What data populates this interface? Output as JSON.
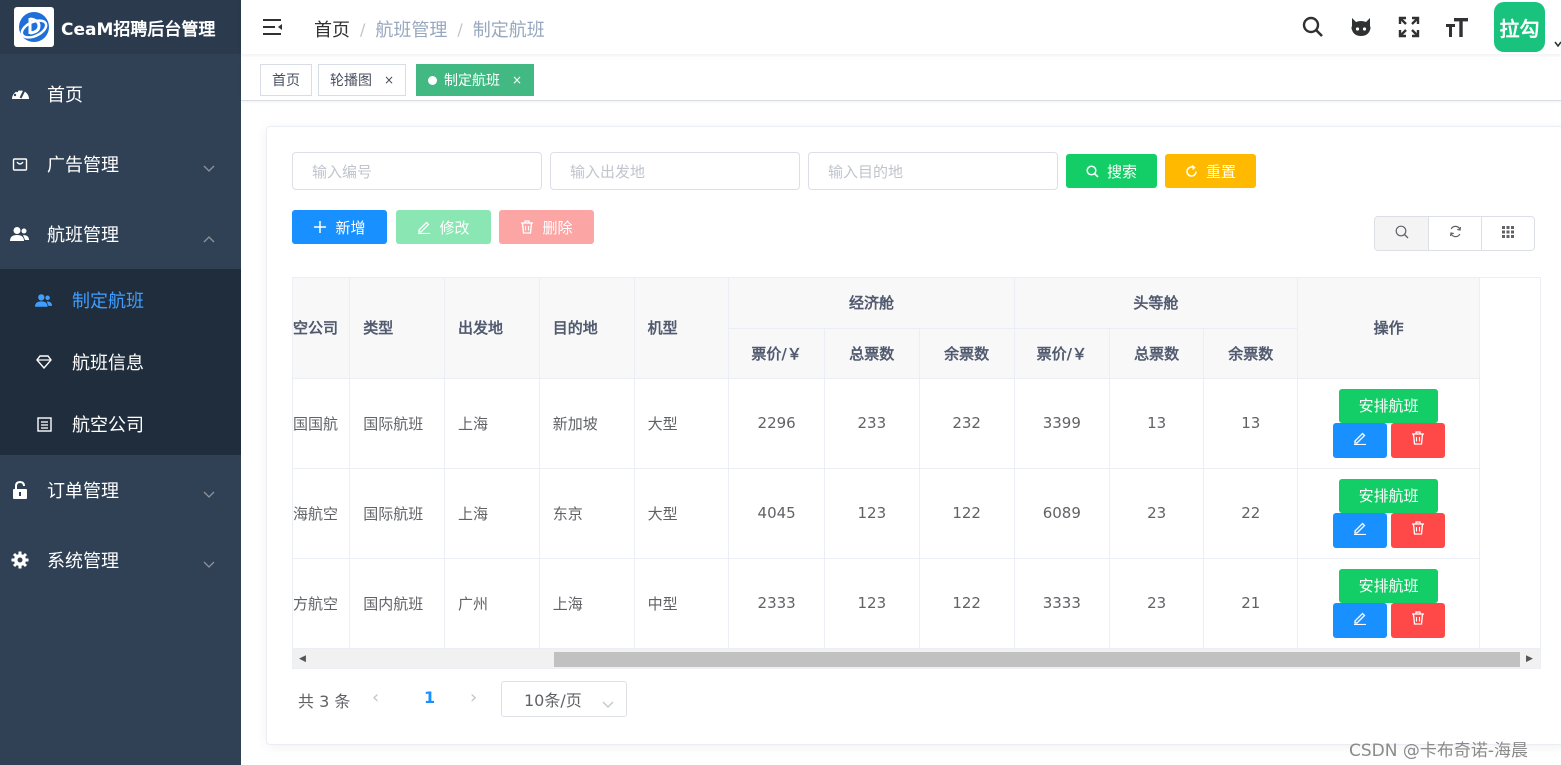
{
  "app": {
    "title": "CeaM招聘后台管理"
  },
  "sidebar": {
    "items": [
      {
        "label": "首页",
        "icon": "dashboard-icon"
      },
      {
        "label": "广告管理",
        "icon": "shopping-bag-icon"
      },
      {
        "label": "航班管理",
        "icon": "users-icon",
        "expanded": true,
        "children": [
          {
            "label": "制定航班",
            "icon": "user-group-icon",
            "active": true
          },
          {
            "label": "航班信息",
            "icon": "diamond-icon"
          },
          {
            "label": "航空公司",
            "icon": "list-icon"
          }
        ]
      },
      {
        "label": "订单管理",
        "icon": "lock-icon"
      },
      {
        "label": "系统管理",
        "icon": "gear-icon"
      }
    ]
  },
  "header": {
    "breadcrumb": [
      "首页",
      "航班管理",
      "制定航班"
    ],
    "avatar_text": "拉勾"
  },
  "tags": [
    {
      "label": "首页"
    },
    {
      "label": "轮播图",
      "closable": true
    },
    {
      "label": "制定航班",
      "closable": true,
      "active": true
    }
  ],
  "search": {
    "code_placeholder": "输入编号",
    "from_placeholder": "输入出发地",
    "to_placeholder": "输入目的地",
    "search_label": "搜索",
    "reset_label": "重置"
  },
  "toolbar": {
    "add_label": "新增",
    "edit_label": "修改",
    "delete_label": "删除"
  },
  "table": {
    "headers": {
      "airline": "空公司",
      "type": "类型",
      "from": "出发地",
      "to": "目的地",
      "model": "机型",
      "economy": "经济舱",
      "first": "头等舱",
      "price": "票价/￥",
      "total": "总票数",
      "remain": "余票数",
      "ops": "操作"
    },
    "arrange_label": "安排航班",
    "rows": [
      {
        "airline": "国国航",
        "type": "国际航班",
        "from": "上海",
        "to": "新加坡",
        "model": "大型",
        "e_price": "2296",
        "e_total": "233",
        "e_remain": "232",
        "f_price": "3399",
        "f_total": "13",
        "f_remain": "13"
      },
      {
        "airline": "海航空",
        "type": "国际航班",
        "from": "上海",
        "to": "东京",
        "model": "大型",
        "e_price": "4045",
        "e_total": "123",
        "e_remain": "122",
        "f_price": "6089",
        "f_total": "23",
        "f_remain": "22"
      },
      {
        "airline": "方航空",
        "type": "国内航班",
        "from": "广州",
        "to": "上海",
        "model": "中型",
        "e_price": "2333",
        "e_total": "123",
        "e_remain": "122",
        "f_price": "3333",
        "f_total": "23",
        "f_remain": "21"
      }
    ]
  },
  "pagination": {
    "total_text": "共 3 条",
    "current_page": "1",
    "page_size": "10条/页"
  },
  "watermark": "CSDN @卡布奇诺-海晨",
  "colors": {
    "sidebar_bg": "#304156",
    "accent_green": "#13ce66",
    "accent_blue": "#1890ff",
    "accent_orange": "#ffba00",
    "danger": "#ff4949",
    "tag_active": "#42b983"
  }
}
